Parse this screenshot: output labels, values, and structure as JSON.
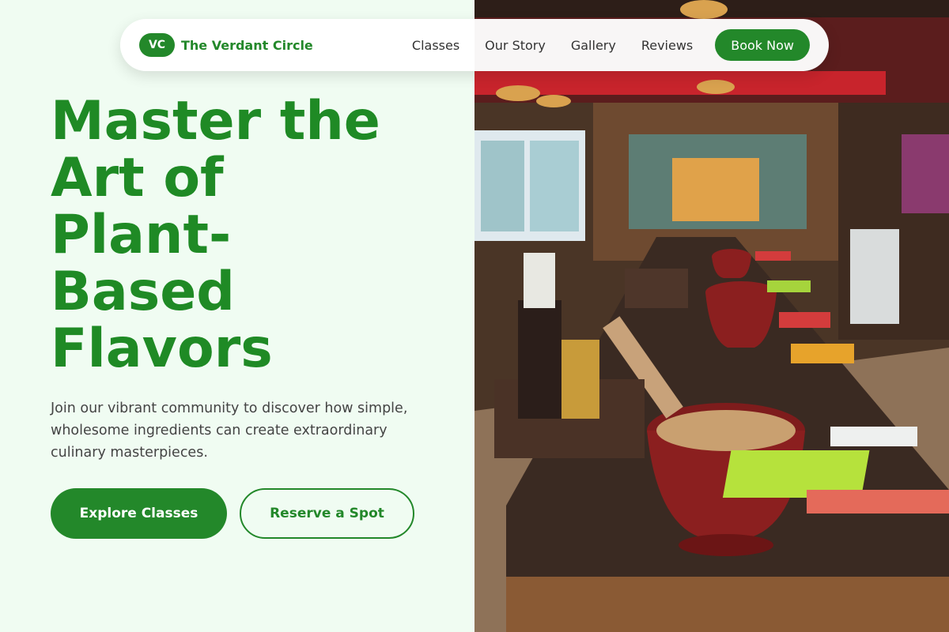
{
  "nav": {
    "logo_initials": "VC",
    "brand_name": "The Verdant Circle",
    "links": [
      "Classes",
      "Our Story",
      "Gallery",
      "Reviews"
    ],
    "cta": "Book Now"
  },
  "hero": {
    "title_lines": [
      "Master the",
      "Art of",
      "Plant-",
      "Based",
      "Flavors"
    ],
    "subtitle": "Join our vibrant community to discover how simple, wholesome ingredients can create extraordinary culinary masterpieces.",
    "primary_button": "Explore Classes",
    "secondary_button": "Reserve a Spot"
  },
  "colors": {
    "brand_green": "#23882a",
    "title_green": "#1f8a25",
    "background": "#f0fcf2"
  }
}
